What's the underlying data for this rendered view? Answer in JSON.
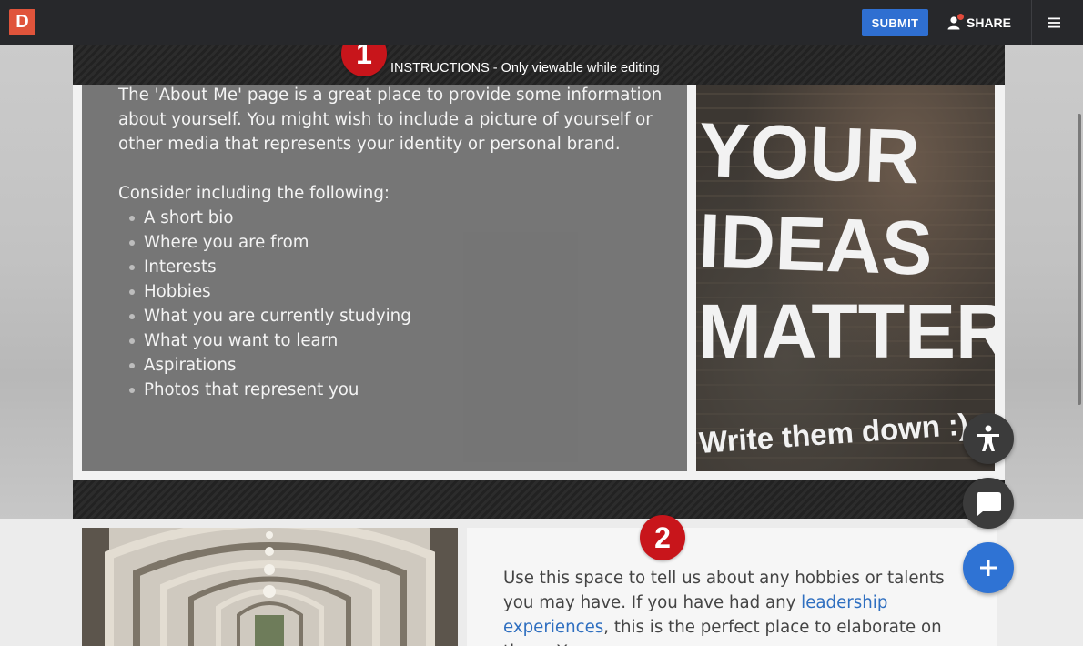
{
  "app": {
    "logo_letter": "D"
  },
  "header": {
    "submit_label": "SUBMIT",
    "share_label": "SHARE"
  },
  "instructions": {
    "badge": "1",
    "label": "INSTRUCTIONS - Only viewable while editing"
  },
  "about": {
    "intro": "The 'About Me' page is a great place to provide some information about yourself. You might wish to include a picture of yourself or other media that represents your identity or personal brand.",
    "consider": "Consider including the following:",
    "items": [
      "A short bio",
      "Where you are from",
      "Interests",
      "Hobbies",
      "What you are currently studying",
      "What you want to learn",
      "Aspirations",
      "Photos that represent you"
    ]
  },
  "poster": {
    "line1": "YOUR",
    "line2": "IDEAS",
    "line3": "MATTER",
    "line4": "Write them down :)"
  },
  "section2": {
    "badge": "2",
    "text_before": "Use this space to tell us about any hobbies or talents you may have. If you have had any ",
    "link_text": "leadership experiences",
    "text_after": ", this is the perfect place to elaborate on them. Y"
  },
  "fabs": {
    "accessibility": "accessibility-icon",
    "chat": "chat-icon",
    "add": "plus-icon"
  },
  "colors": {
    "topbar": "#27282b",
    "submit": "#2f6fd1",
    "badge": "#c8151b",
    "fab_blue": "#2f73d4",
    "link": "#2f6fc0",
    "logo": "#e0543b"
  }
}
